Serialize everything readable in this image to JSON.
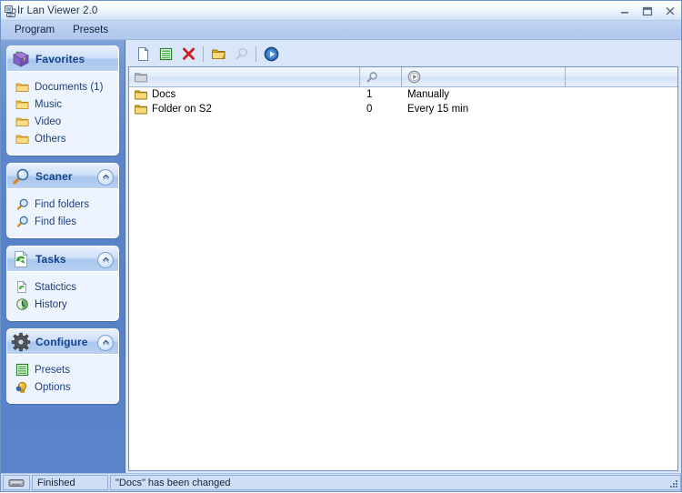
{
  "window": {
    "title": "Ir Lan Viewer 2.0",
    "title_icon": "app-network-icon",
    "controls": [
      {
        "name": "minimize-button",
        "glyph": "minimize-icon"
      },
      {
        "name": "maximize-button",
        "glyph": "maximize-icon"
      },
      {
        "name": "close-button",
        "glyph": "close-icon"
      }
    ]
  },
  "menubar": {
    "items": [
      {
        "label": "Program",
        "name": "menu-program"
      },
      {
        "label": "Presets",
        "name": "menu-presets"
      }
    ]
  },
  "sidebar": {
    "panels": [
      {
        "title": "Favorites",
        "icon": "favorites-book-icon",
        "collapsible": false,
        "items": [
          {
            "label": "Documents (1)",
            "icon": "folder-icon"
          },
          {
            "label": "Music",
            "icon": "folder-icon"
          },
          {
            "label": "Video",
            "icon": "folder-icon"
          },
          {
            "label": "Others",
            "icon": "folder-icon"
          }
        ]
      },
      {
        "title": "Scaner",
        "icon": "magnifier-icon",
        "collapsible": true,
        "items": [
          {
            "label": "Find folders",
            "icon": "magnifier-icon"
          },
          {
            "label": "Find files",
            "icon": "magnifier-icon"
          }
        ]
      },
      {
        "title": "Tasks",
        "icon": "refresh-page-icon",
        "collapsible": true,
        "items": [
          {
            "label": "Statictics",
            "icon": "statistics-page-icon"
          },
          {
            "label": "History",
            "icon": "history-clock-icon"
          }
        ]
      },
      {
        "title": "Configure",
        "icon": "gear-icon",
        "collapsible": true,
        "items": [
          {
            "label": "Presets",
            "icon": "list-icon"
          },
          {
            "label": "Options",
            "icon": "options-bulb-icon"
          }
        ]
      }
    ]
  },
  "toolbar": {
    "buttons": [
      {
        "name": "new-document-button",
        "icon": "new-document-icon",
        "enabled": true
      },
      {
        "name": "edit-list-button",
        "icon": "list-green-icon",
        "enabled": true
      },
      {
        "name": "delete-button",
        "icon": "delete-x-icon",
        "enabled": true
      },
      {
        "name": "open-folder-button",
        "icon": "open-folder-icon",
        "enabled": true
      },
      {
        "name": "search-button",
        "icon": "magnifier-icon",
        "enabled": false
      },
      {
        "name": "run-button",
        "icon": "play-circle-icon",
        "enabled": true
      }
    ]
  },
  "list": {
    "columns": [
      {
        "name": "column-folder",
        "icon": "folder-icon"
      },
      {
        "name": "column-found",
        "icon": "magnifier-icon"
      },
      {
        "name": "column-schedule",
        "icon": "play-circle-icon"
      },
      {
        "name": "column-extra",
        "icon": ""
      }
    ],
    "rows": [
      {
        "folder": "Docs",
        "found": "1",
        "schedule": "Manually",
        "extra": ""
      },
      {
        "folder": "Folder on S2",
        "found": "0",
        "schedule": "Every 15 min",
        "extra": ""
      }
    ]
  },
  "statusbar": {
    "icon": "lan-connection-icon",
    "state": "Finished",
    "message": "\"Docs\" has been changed",
    "grip": "resize-grip-icon"
  },
  "colors": {
    "accent": "#15438b",
    "sidebar": "#5781c8",
    "link": "#1c3f7d",
    "folder": "#f5c33a",
    "delete": "#cc2222",
    "green": "#3aa03a"
  }
}
